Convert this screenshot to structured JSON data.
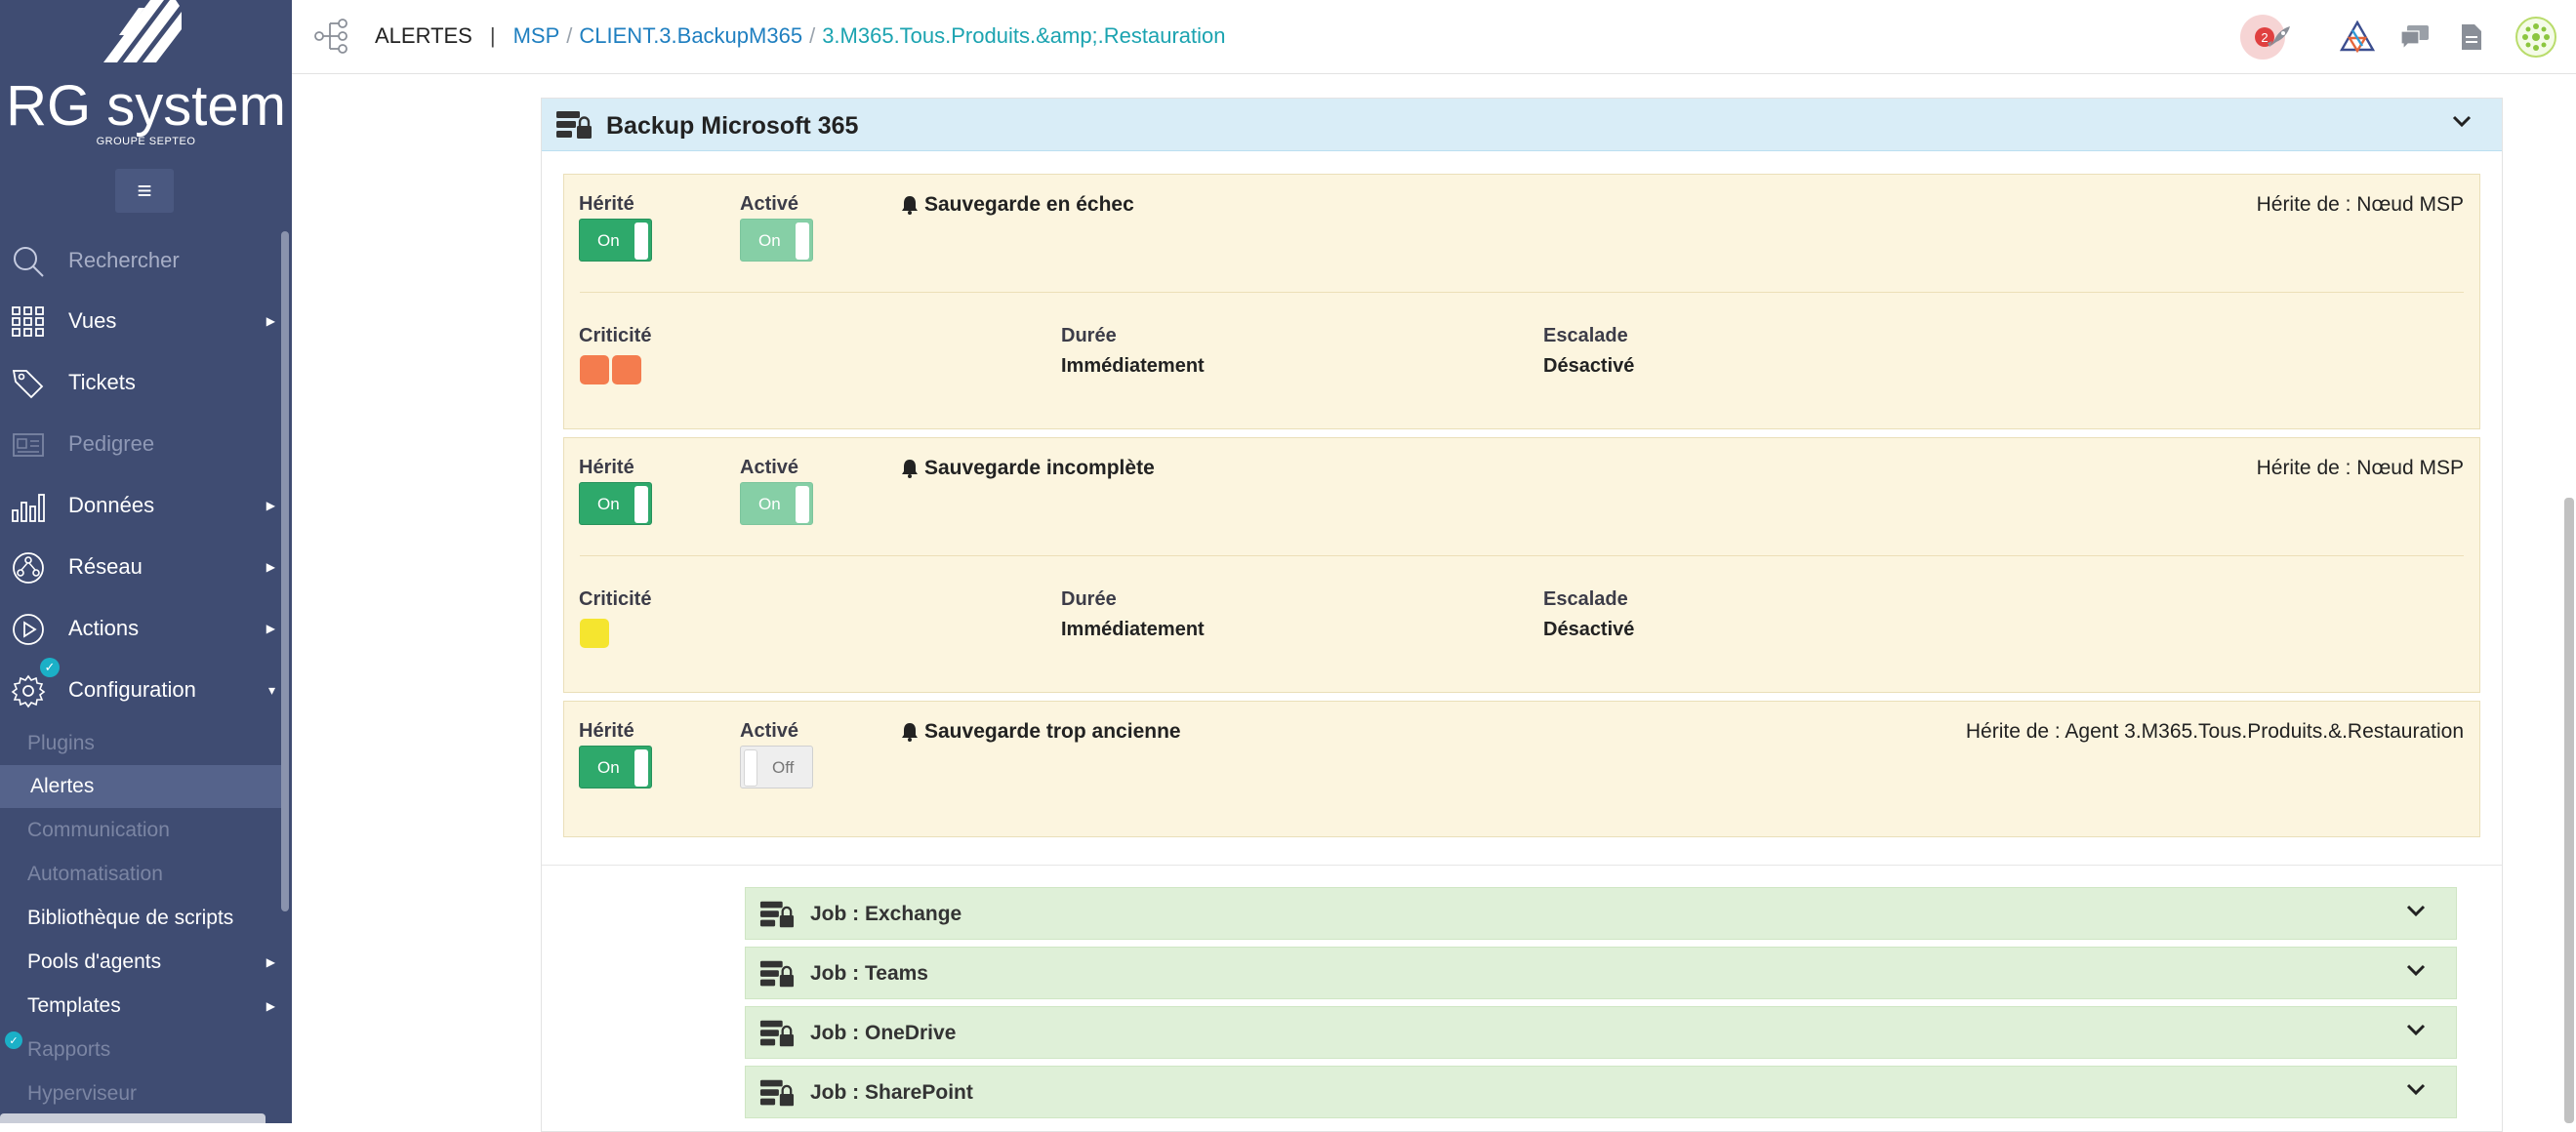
{
  "sidebar": {
    "brand": "RG system",
    "brand_sub": "GROUPE SEPTEO",
    "menu_icon": "hamburger-icon",
    "items": [
      {
        "label": "Rechercher",
        "icon": "search-icon"
      },
      {
        "label": "Vues",
        "icon": "grid-icon"
      },
      {
        "label": "Tickets",
        "icon": "tag-icon"
      },
      {
        "label": "Pedigree",
        "icon": "id-card-icon"
      },
      {
        "label": "Données",
        "icon": "bar-chart-icon"
      },
      {
        "label": "Réseau",
        "icon": "network-icon"
      },
      {
        "label": "Actions",
        "icon": "play-icon"
      },
      {
        "label": "Configuration",
        "icon": "gear-icon"
      }
    ],
    "sub_items": [
      {
        "label": "Plugins"
      },
      {
        "label": "Alertes"
      },
      {
        "label": "Communication"
      },
      {
        "label": "Automatisation"
      },
      {
        "label": "Bibliothèque de scripts"
      },
      {
        "label": "Pools d'agents"
      },
      {
        "label": "Templates"
      },
      {
        "label": "Rapports"
      },
      {
        "label": "Hyperviseur"
      }
    ]
  },
  "topbar": {
    "section": "ALERTES",
    "separator": "|",
    "crumbs": [
      "MSP",
      "CLIENT.3.BackupM365"
    ],
    "crumb_sep": "/",
    "current": "3.M365.Tous.Produits.&amp;.Restauration",
    "notification_count": "2",
    "colors": {
      "accent_link": "#1f7fc0",
      "current": "#1ba3b0",
      "badge": "#e04040"
    }
  },
  "panel": {
    "title": "Backup Microsoft 365",
    "labels": {
      "inherited": "Hérité",
      "enabled": "Activé",
      "criticality": "Criticité",
      "duration": "Durée",
      "escalation": "Escalade"
    },
    "alerts": [
      {
        "name": "Sauvegarde en échec",
        "inherited_toggle": "On",
        "enabled_toggle": "On",
        "inherits_from": "Hérite de : Nœud MSP",
        "duration": "Immédiatement",
        "escalation": "Désactivé",
        "criticality_colors": [
          "#f47c4e",
          "#f47c4e"
        ]
      },
      {
        "name": "Sauvegarde incomplète",
        "inherited_toggle": "On",
        "enabled_toggle": "On",
        "inherits_from": "Hérite de : Nœud MSP",
        "duration": "Immédiatement",
        "escalation": "Désactivé",
        "criticality_colors": [
          "#f5e52f"
        ]
      },
      {
        "name": "Sauvegarde trop ancienne",
        "inherited_toggle": "On",
        "enabled_toggle": "Off",
        "inherits_from": "Hérite de : Agent 3.M365.Tous.Produits.&.Restauration"
      }
    ],
    "jobs": [
      {
        "title": "Job : Exchange"
      },
      {
        "title": "Job : Teams"
      },
      {
        "title": "Job : OneDrive"
      },
      {
        "title": "Job : SharePoint"
      }
    ]
  }
}
